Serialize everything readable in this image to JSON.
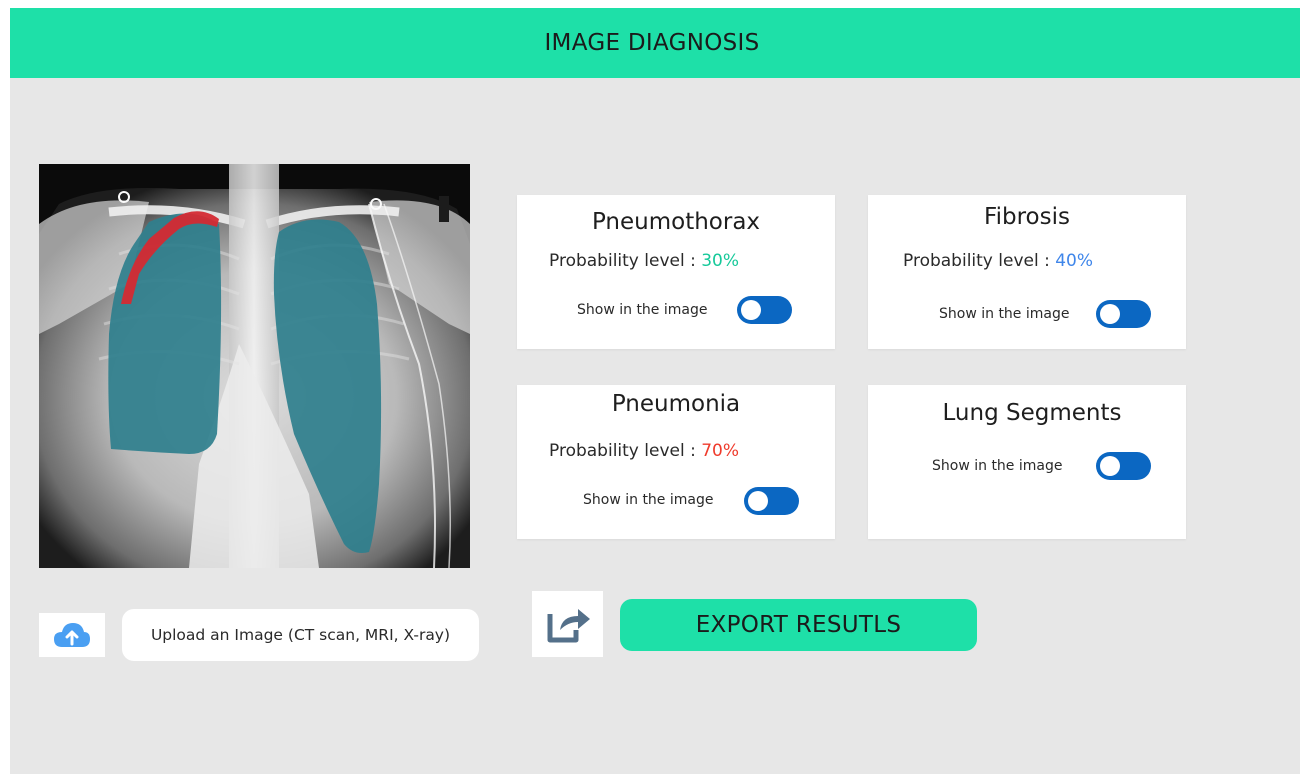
{
  "header": {
    "title": "IMAGE DIAGNOSIS"
  },
  "xray": {
    "description_icon": "chest-xray-image",
    "overlay_colors": {
      "lung": "#2f7f8d",
      "pneumothorax": "#d42a33"
    }
  },
  "cards": {
    "pneumothorax": {
      "title": "Pneumothorax",
      "prob_label": "Probability level :",
      "prob_value": "30%",
      "show_label": "Show in the image",
      "toggle_on": true
    },
    "fibrosis": {
      "title": "Fibrosis",
      "prob_label": "Probability level :",
      "prob_value": "40%",
      "show_label": "Show in the image",
      "toggle_on": true
    },
    "pneumonia": {
      "title": "Pneumonia",
      "prob_label": "Probability level :",
      "prob_value": "70%",
      "show_label": "Show in the image",
      "toggle_on": true
    },
    "lung_segments": {
      "title": "Lung Segments",
      "show_label": "Show in the image",
      "toggle_on": true
    }
  },
  "upload": {
    "icon": "cloud-upload-icon",
    "label": "Upload an Image (CT scan, MRI, X-ray)"
  },
  "export": {
    "icon": "share-export-icon",
    "label": "EXPORT RESUTLS"
  },
  "colors": {
    "accent": "#1ee0a8",
    "toggle": "#0b67c2",
    "prob_green": "#16c99a",
    "prob_blue": "#3f86ea",
    "prob_red": "#ef3b2c",
    "background": "#e7e7e7"
  }
}
